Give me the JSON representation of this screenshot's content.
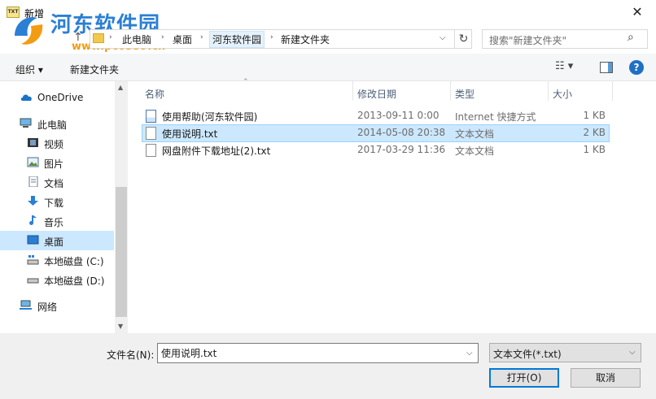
{
  "window": {
    "title": "新增",
    "app_icon_text": "TXT",
    "close_glyph": "✕"
  },
  "watermark": {
    "name": "河东软件园",
    "url": "www.pc0359.cn"
  },
  "address": {
    "crumbs": [
      "此电脑",
      "桌面",
      "河东软件园",
      "新建文件夹"
    ],
    "search_placeholder": "搜索\"新建文件夹\""
  },
  "toolbar": {
    "organize_label": "组织 ▾",
    "new_folder_label": "新建文件夹",
    "help_glyph": "?"
  },
  "nav": {
    "items": [
      {
        "label": "OneDrive",
        "icon": "cloud-icon"
      },
      {
        "label": "此电脑",
        "icon": "computer-icon"
      },
      {
        "label": "视频",
        "icon": "video-icon"
      },
      {
        "label": "图片",
        "icon": "picture-icon"
      },
      {
        "label": "文档",
        "icon": "document-icon"
      },
      {
        "label": "下载",
        "icon": "download-icon"
      },
      {
        "label": "音乐",
        "icon": "music-icon"
      },
      {
        "label": "桌面",
        "icon": "desktop-icon"
      },
      {
        "label": "本地磁盘 (C:)",
        "icon": "drive-icon"
      },
      {
        "label": "本地磁盘 (D:)",
        "icon": "drive-icon"
      },
      {
        "label": "网络",
        "icon": "network-icon"
      }
    ]
  },
  "columns": [
    "名称",
    "修改日期",
    "类型",
    "大小"
  ],
  "files": [
    {
      "name": "使用帮助(河东软件园)",
      "date": "2013-09-11 0:00",
      "type": "Internet 快捷方式",
      "size": "1 KB"
    },
    {
      "name": "使用说明.txt",
      "date": "2014-05-08 20:38",
      "type": "文本文档",
      "size": "2 KB"
    },
    {
      "name": "网盘附件下载地址(2).txt",
      "date": "2017-03-29 11:36",
      "type": "文本文档",
      "size": "1 KB"
    }
  ],
  "bottom": {
    "filename_label": "文件名(N):",
    "filename_value": "使用说明.txt",
    "filter_label": "文本文件(*.txt)",
    "open_label": "打开(O)",
    "cancel_label": "取消"
  }
}
